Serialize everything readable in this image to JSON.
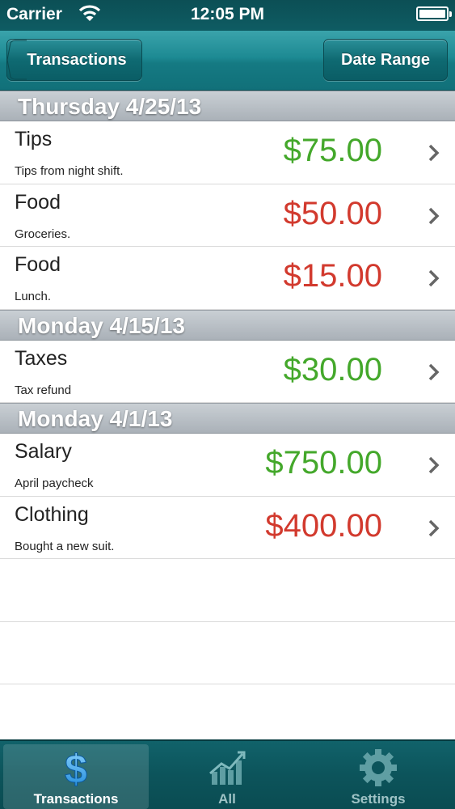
{
  "status": {
    "carrier": "Carrier",
    "time": "12:05 PM"
  },
  "nav": {
    "back_label": "Transactions",
    "range_label": "Date Range"
  },
  "sections": [
    {
      "title": "Thursday 4/25/13",
      "rows": [
        {
          "category": "Tips",
          "note": "Tips from night shift.",
          "amount": "$75.00",
          "kind": "pos"
        },
        {
          "category": "Food",
          "note": "Groceries.",
          "amount": "$50.00",
          "kind": "neg"
        },
        {
          "category": "Food",
          "note": "Lunch.",
          "amount": "$15.00",
          "kind": "neg"
        }
      ]
    },
    {
      "title": "Monday 4/15/13",
      "rows": [
        {
          "category": "Taxes",
          "note": "Tax refund",
          "amount": "$30.00",
          "kind": "pos"
        }
      ]
    },
    {
      "title": "Monday 4/1/13",
      "rows": [
        {
          "category": "Salary",
          "note": "April paycheck",
          "amount": "$750.00",
          "kind": "pos"
        },
        {
          "category": "Clothing",
          "note": "Bought a new suit.",
          "amount": "$400.00",
          "kind": "neg"
        }
      ]
    }
  ],
  "tabs": [
    {
      "label": "Transactions",
      "icon": "dollar-icon",
      "active": true
    },
    {
      "label": "All",
      "icon": "chart-icon",
      "active": false
    },
    {
      "label": "Settings",
      "icon": "gear-icon",
      "active": false
    }
  ],
  "colors": {
    "positive": "#44a82b",
    "negative": "#d23a2e",
    "navbar": "#1d8a93"
  }
}
